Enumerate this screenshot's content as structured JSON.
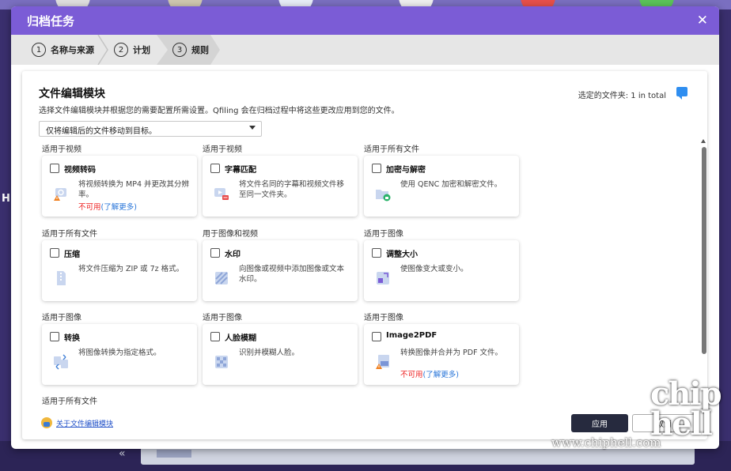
{
  "background": {
    "left_text": "H"
  },
  "dialog": {
    "title": "归档任务"
  },
  "steps": [
    {
      "num": "1",
      "label": "名称与来源"
    },
    {
      "num": "2",
      "label": "计划"
    },
    {
      "num": "3",
      "label": "规则"
    }
  ],
  "panel": {
    "title": "文件编辑模块",
    "description": "选择文件编辑模块并根据您的需要配置所需设置。Qfiling 会在归档过程中将这些更改应用到您的文件。",
    "selected_folders": "选定的文件夹: 1 in total",
    "select_value": "仅将编辑后的文件移动到目标。"
  },
  "groups": [
    {
      "label": "适用于视频"
    },
    {
      "label": "适用于视频"
    },
    {
      "label": "适用于所有文件"
    },
    {
      "label": "适用于所有文件"
    },
    {
      "label": "用于图像和视频"
    },
    {
      "label": "适用于图像"
    },
    {
      "label": "适用于图像"
    },
    {
      "label": "适用于图像"
    },
    {
      "label": "适用于图像"
    },
    {
      "label": "适用于所有文件"
    }
  ],
  "modules": [
    {
      "name": "视频转码",
      "text": "将视频转换为 MP4 并更改其分辨率。",
      "unavailable": "不可用",
      "learn_more": "(了解更多)",
      "icon": "video-transcode-icon"
    },
    {
      "name": "字幕匹配",
      "text": "将文件名同的字幕和视频文件移至同一文件夹。",
      "icon": "subtitle-icon"
    },
    {
      "name": "加密与解密",
      "text": "使用 QENC 加密和解密文件。",
      "icon": "lock-folder-icon"
    },
    {
      "name": "压缩",
      "text": "将文件压缩为 ZIP 或 7z 格式。",
      "icon": "zip-icon"
    },
    {
      "name": "水印",
      "text": "向图像或视频中添加图像或文本水印。",
      "icon": "watermark-icon"
    },
    {
      "name": "调整大小",
      "text": "使图像变大或变小。",
      "icon": "resize-icon"
    },
    {
      "name": "转换",
      "text": "将图像转换为指定格式。",
      "icon": "convert-icon"
    },
    {
      "name": "人脸模糊",
      "text": "识别并模糊人脸。",
      "icon": "face-blur-icon"
    },
    {
      "name": "Image2PDF",
      "text": "转换图像并合并为 PDF 文件。",
      "unavailable": "不可用",
      "learn_more": "(了解更多)",
      "icon": "pdf-icon"
    }
  ],
  "about_link": "关于文件编辑模块",
  "buttons": {
    "apply": "应用",
    "cancel": "取消"
  },
  "watermark": {
    "site": "www.chiphell.com",
    "logo": "chip hell"
  }
}
